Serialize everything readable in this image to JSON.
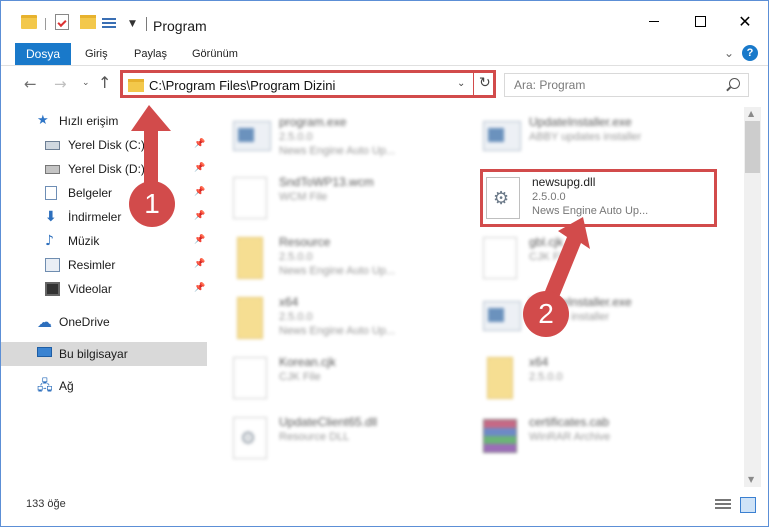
{
  "window": {
    "title": "Program",
    "controls": {
      "minimize": "—",
      "maximize": "☐",
      "close": "✕"
    }
  },
  "ribbon": {
    "tabs": [
      "Dosya",
      "Giriş",
      "Paylaş",
      "Görünüm"
    ],
    "help": "?"
  },
  "nav": {
    "address": "C:\\Program Files\\Program Dizini",
    "search_placeholder": "Ara: Program"
  },
  "sidebar": {
    "items": [
      {
        "label": "Hızlı erişim",
        "icon": "star-icon"
      },
      {
        "label": "Yerel Disk (C:)",
        "icon": "drive-icon"
      },
      {
        "label": "Yerel Disk (D:)",
        "icon": "drive-icon"
      },
      {
        "label": "Belgeler",
        "icon": "documents-icon"
      },
      {
        "label": "İndirmeler",
        "icon": "downloads-icon"
      },
      {
        "label": "Müzik",
        "icon": "music-icon"
      },
      {
        "label": "Resimler",
        "icon": "pictures-icon"
      },
      {
        "label": "Videolar",
        "icon": "videos-icon"
      },
      {
        "label": "OneDrive",
        "icon": "cloud-icon"
      },
      {
        "label": "Bu bilgisayar",
        "icon": "computer-icon"
      },
      {
        "label": "Ağ",
        "icon": "network-icon"
      }
    ]
  },
  "files": {
    "left": [
      {
        "name": "program.exe",
        "sub1": "2.5.0.0",
        "sub2": "News Engine Auto Up..."
      },
      {
        "name": "SndToWP13.wcm",
        "sub1": "WCM File",
        "sub2": ""
      },
      {
        "name": "Resource",
        "sub1": "2.5.0.0",
        "sub2": "News Engine Auto Up..."
      },
      {
        "name": "x64",
        "sub1": "2.5.0.0",
        "sub2": "News Engine Auto Up..."
      },
      {
        "name": "Korean.cjk",
        "sub1": "CJK File",
        "sub2": ""
      },
      {
        "name": "UpdateClient65.dll",
        "sub1": "Resource DLL",
        "sub2": ""
      }
    ],
    "right": [
      {
        "name": "UpdateInstaller.exe",
        "sub1": "ABBY updates installer",
        "sub2": ""
      },
      {
        "name": "newsupg.dll",
        "sub1": "2.5.0.0",
        "sub2": "News Engine Auto Up..."
      },
      {
        "name": "gbl.cjk",
        "sub1": "CJK File",
        "sub2": ""
      },
      {
        "name": "UpdateInstaller.exe",
        "sub1": "updates installer",
        "sub2": ""
      },
      {
        "name": "x64",
        "sub1": "2.5.0.0",
        "sub2": ""
      },
      {
        "name": "certificates.cab",
        "sub1": "WinRAR Archive",
        "sub2": ""
      }
    ]
  },
  "status": {
    "count": "133 öğe"
  },
  "annotations": {
    "step1": "1",
    "step2": "2",
    "color": "#d24b4b"
  }
}
